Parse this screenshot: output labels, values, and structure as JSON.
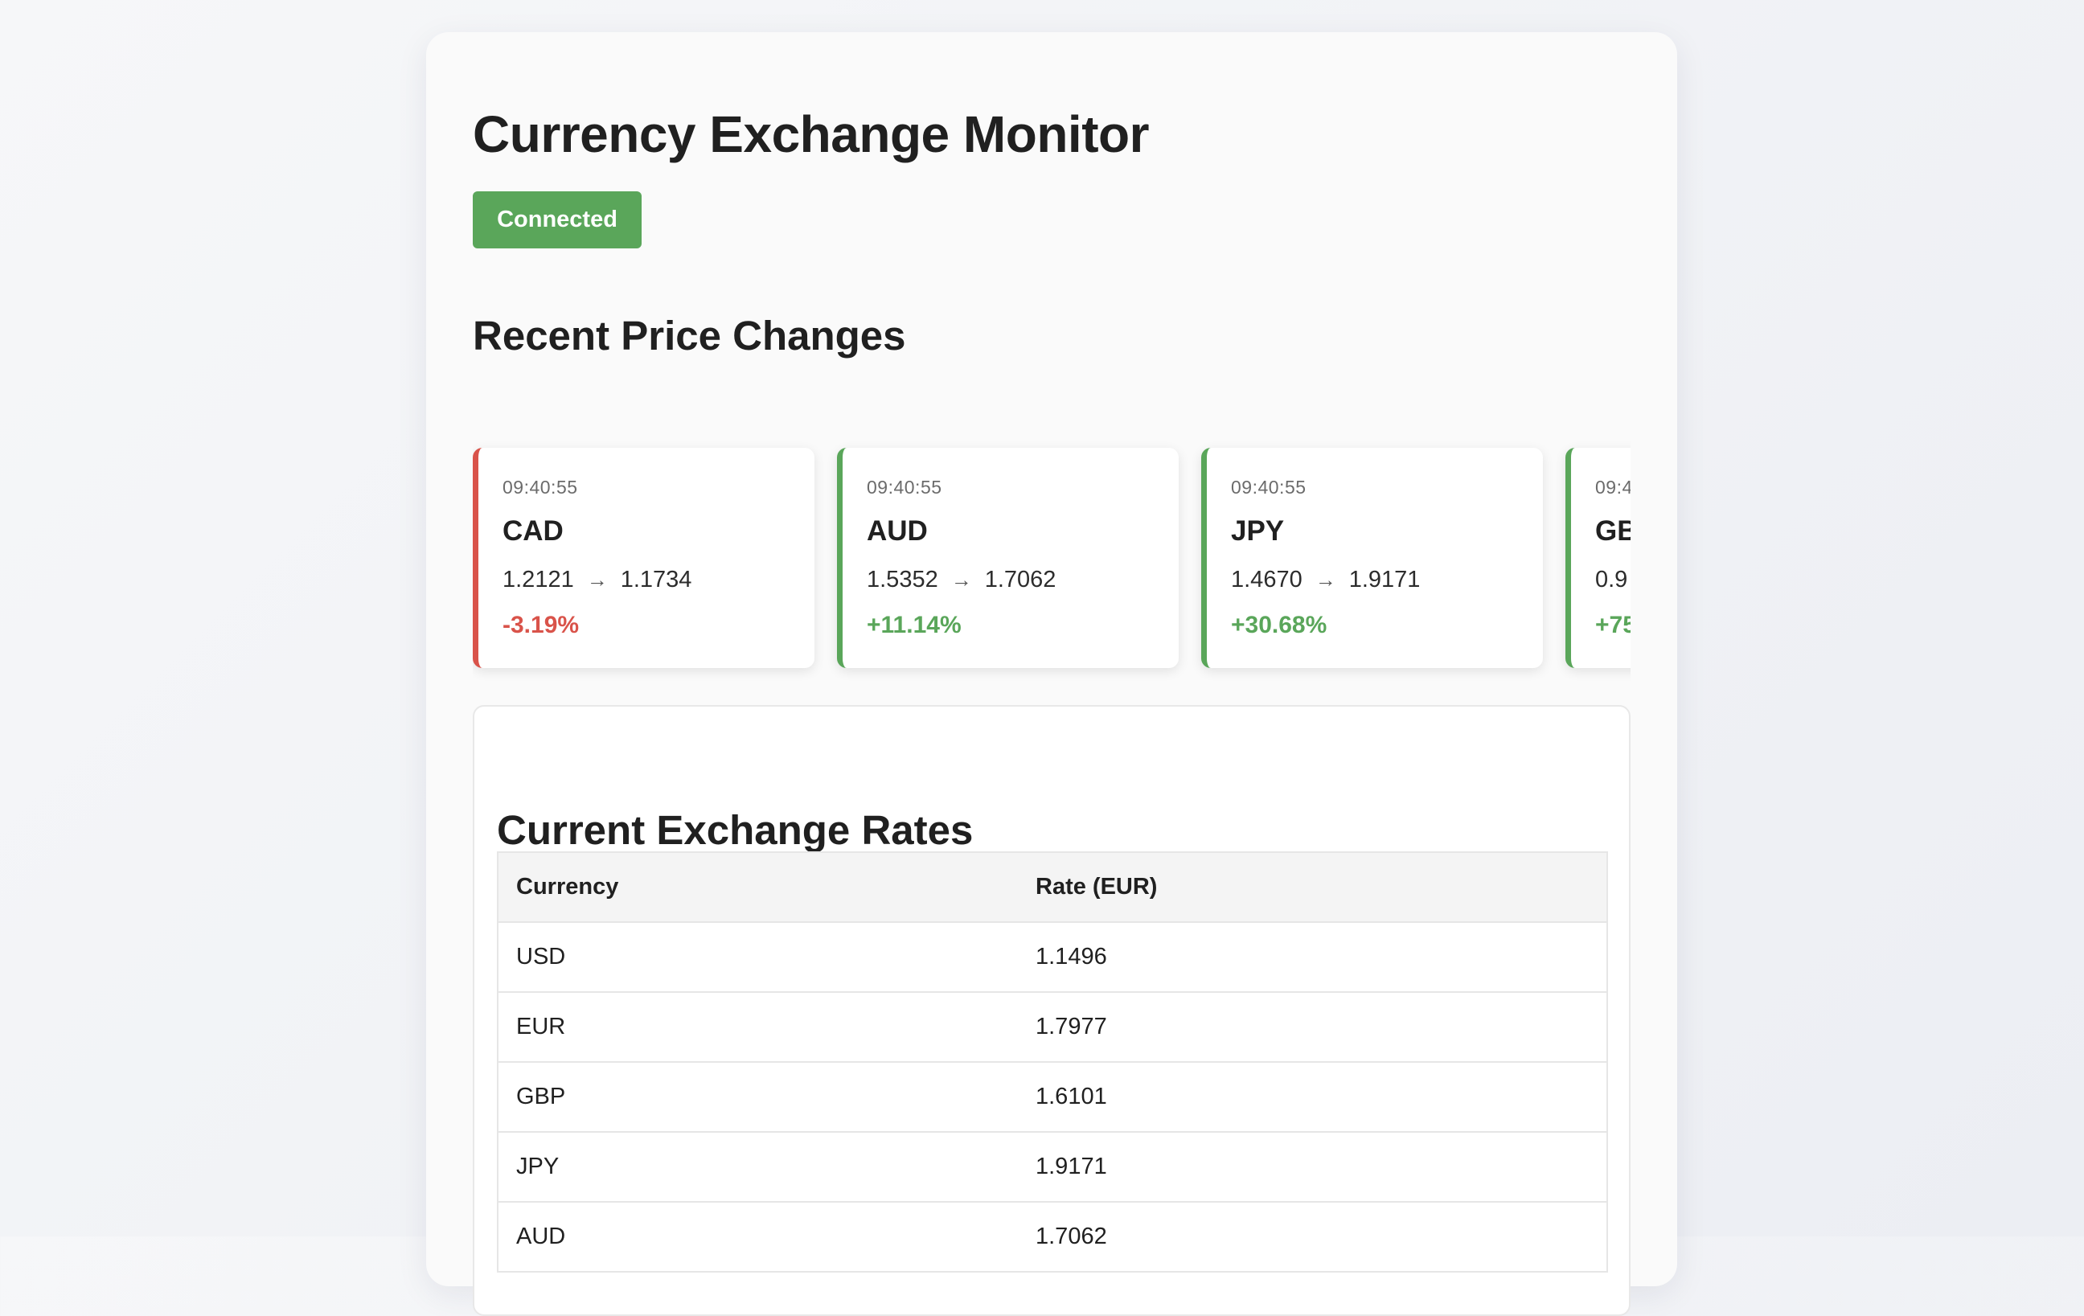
{
  "header": {
    "title": "Currency Exchange Monitor",
    "status": "Connected"
  },
  "recent": {
    "title": "Recent Price Changes",
    "cards": [
      {
        "time": "09:40:55",
        "currency": "CAD",
        "from": "1.2121",
        "to": "1.1734",
        "change": "-3.19%",
        "direction": "down"
      },
      {
        "time": "09:40:55",
        "currency": "AUD",
        "from": "1.5352",
        "to": "1.7062",
        "change": "+11.14%",
        "direction": "up"
      },
      {
        "time": "09:40:55",
        "currency": "JPY",
        "from": "1.4670",
        "to": "1.9171",
        "change": "+30.68%",
        "direction": "up"
      },
      {
        "time": "09:4",
        "currency": "GB",
        "from": "0.9",
        "to": "",
        "change": "+75",
        "direction": "up"
      }
    ]
  },
  "rates": {
    "title": "Current Exchange Rates",
    "columns": [
      "Currency",
      "Rate (EUR)"
    ],
    "rows": [
      {
        "currency": "USD",
        "rate": "1.1496"
      },
      {
        "currency": "EUR",
        "rate": "1.7977"
      },
      {
        "currency": "GBP",
        "rate": "1.6101"
      },
      {
        "currency": "JPY",
        "rate": "1.9171"
      },
      {
        "currency": "AUD",
        "rate": "1.7062"
      }
    ]
  },
  "colors": {
    "up": "#5aa65a",
    "down": "#d9534a",
    "status": "#5aa65a"
  }
}
